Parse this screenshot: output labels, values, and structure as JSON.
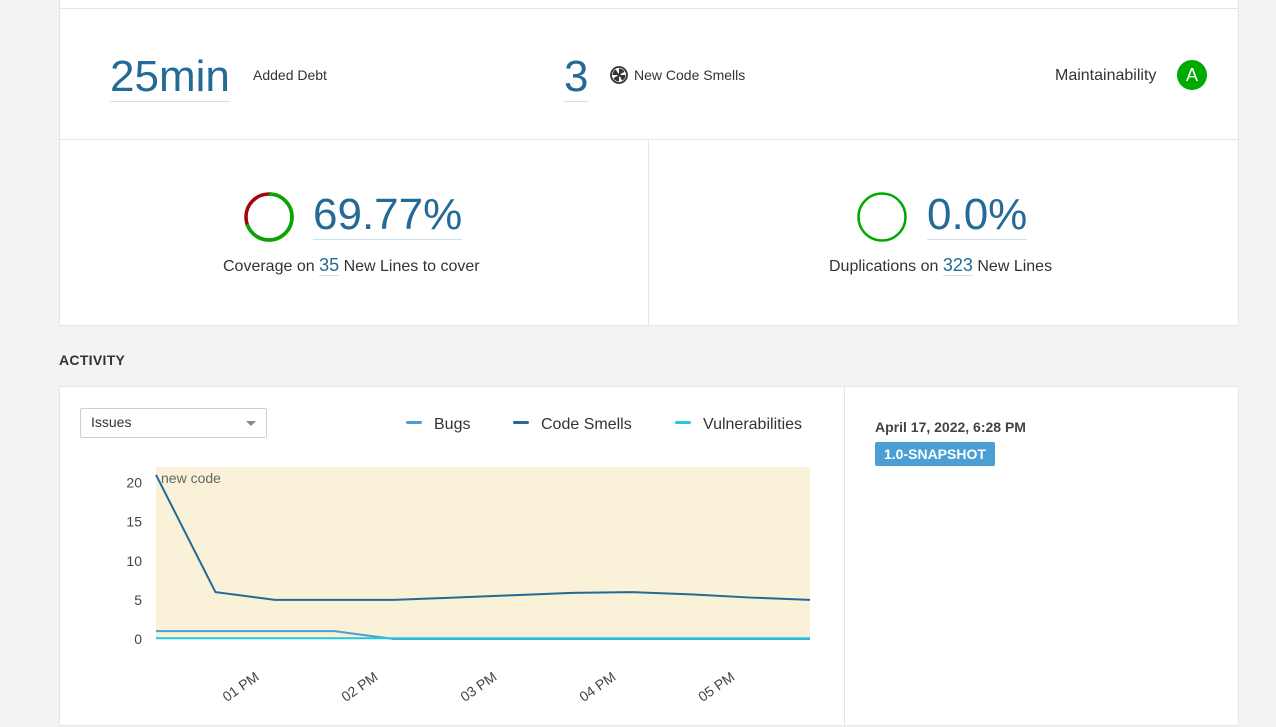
{
  "leak": {
    "added_debt": {
      "value": "25min",
      "label": "Added Debt"
    },
    "code_smells": {
      "value": "3",
      "label": "New Code Smells"
    },
    "maintainability": {
      "label": "Maintainability",
      "rating": "A",
      "rating_color": "#00aa00"
    }
  },
  "coverage": {
    "value": "69.77%",
    "prefix": "Coverage on",
    "lines": "35",
    "suffix": "New Lines to cover",
    "covered_fraction": 0.6977,
    "covered_color": "#00aa00",
    "uncovered_color": "#a4030f"
  },
  "duplications": {
    "value": "0.0%",
    "prefix": "Duplications on",
    "lines": "323",
    "suffix": "New Lines",
    "ring_color": "#00aa00"
  },
  "activity": {
    "title": "ACTIVITY",
    "metric_select": "Issues",
    "snapshot": {
      "date": "April 17, 2022, 6:28 PM",
      "version": "1.0-SNAPSHOT"
    }
  },
  "chart_data": {
    "type": "line",
    "annotation": "new code",
    "ylim": [
      0,
      22
    ],
    "yticks": [
      0,
      5,
      10,
      15,
      20
    ],
    "x": [
      "12:10",
      "12:45",
      "13:15",
      "13:45",
      "14:15",
      "14:45",
      "15:15",
      "15:45",
      "16:15",
      "16:45",
      "17:15",
      "17:45"
    ],
    "x_ticks": [
      {
        "label": "01 PM",
        "pos": 1.75
      },
      {
        "label": "02 PM",
        "pos": 3.75
      },
      {
        "label": "03 PM",
        "pos": 5.75
      },
      {
        "label": "04 PM",
        "pos": 7.75
      },
      {
        "label": "05 PM",
        "pos": 9.75
      }
    ],
    "series": [
      {
        "name": "Bugs",
        "color": "#4b9fd5",
        "values": [
          1,
          1,
          1,
          1,
          0,
          0,
          0,
          0,
          0,
          0,
          0,
          0
        ]
      },
      {
        "name": "Code Smells",
        "color": "#236a97",
        "values": [
          21,
          6,
          5,
          5,
          5,
          5.3,
          5.6,
          5.9,
          6,
          5.7,
          5.3,
          5
        ]
      },
      {
        "name": "Vulnerabilities",
        "color": "#24c6e0",
        "values": [
          0.1,
          0.1,
          0.1,
          0.1,
          0.1,
          0.1,
          0.1,
          0.1,
          0.1,
          0.1,
          0.1,
          0.1
        ]
      }
    ],
    "area_color": "#f9f1d8",
    "grid": false
  }
}
